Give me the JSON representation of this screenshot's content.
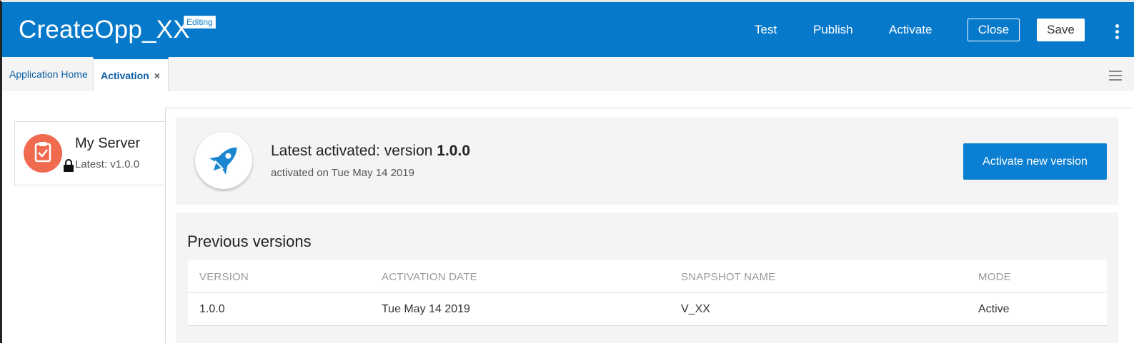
{
  "header": {
    "app_title": "CreateOpp_XX",
    "badge": "Editing",
    "links": {
      "test": "Test",
      "publish": "Publish",
      "activate": "Activate"
    },
    "close_label": "Close",
    "save_label": "Save"
  },
  "tabs": [
    {
      "label": "Application Home"
    },
    {
      "label": "Activation",
      "active": true,
      "close": "×"
    }
  ],
  "server": {
    "name": "My Server",
    "latest": "Latest: v1.0.0",
    "icon": "clipboard-check-icon"
  },
  "latest": {
    "prefix": "Latest activated: version ",
    "version": "1.0.0",
    "subtitle": "activated on Tue May 14 2019",
    "button": "Activate new version",
    "icon": "rocket-icon"
  },
  "previous": {
    "title": "Previous versions",
    "columns": [
      "VERSION",
      "ACTIVATION DATE",
      "SNAPSHOT NAME",
      "MODE"
    ],
    "rows": [
      [
        "1.0.0",
        "Tue May 14 2019",
        "V_XX",
        "Active"
      ]
    ]
  },
  "colors": {
    "brand": "#0779cb",
    "server_icon": "#ef6a4f",
    "panel": "#f4f4f4"
  }
}
